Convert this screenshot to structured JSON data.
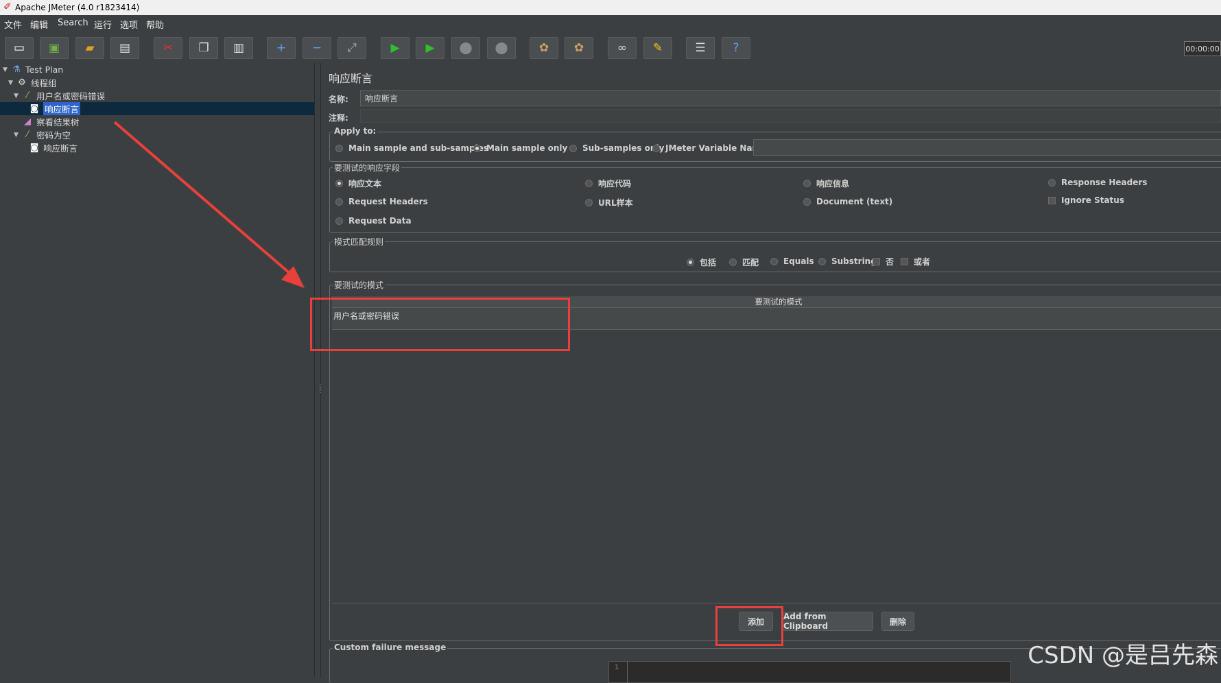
{
  "window": {
    "title": "Apache JMeter (4.0 r1823414)"
  },
  "menubar": {
    "items": [
      "文件",
      "编辑",
      "Search",
      "运行",
      "选项",
      "帮助"
    ]
  },
  "toolbar": {
    "buttons": [
      "new-icon",
      "templates-icon",
      "open-icon",
      "save-icon",
      "cut-icon",
      "copy-icon",
      "paste-icon",
      "expand-icon",
      "collapse-icon",
      "toggle-icon",
      "start-icon",
      "start-no-pause-icon",
      "stop-icon",
      "shutdown-icon",
      "clear-icon",
      "clear-all-icon",
      "search-icon",
      "reset-search-icon",
      "function-helper-icon",
      "help-icon"
    ],
    "timer": "00:00:00"
  },
  "tree": {
    "nodes": [
      {
        "label": "Test Plan",
        "depth": 0,
        "icon": "flask-icon"
      },
      {
        "label": "线程组",
        "depth": 1,
        "icon": "gear-icon"
      },
      {
        "label": "用户名或密码错误",
        "depth": 2,
        "icon": "pipette-icon"
      },
      {
        "label": "响应断言",
        "depth": 3,
        "icon": "assertion-icon",
        "selected": true
      },
      {
        "label": "察看结果树",
        "depth": 2,
        "icon": "chart-icon"
      },
      {
        "label": "密码为空",
        "depth": 2,
        "icon": "pipette-icon"
      },
      {
        "label": "响应断言",
        "depth": 3,
        "icon": "assertion-icon"
      }
    ]
  },
  "panel": {
    "title": "响应断言",
    "name_label": "名称:",
    "name_value": "响应断言",
    "comment_label": "注释:",
    "apply_to": {
      "title": "Apply to:",
      "options": [
        "Main sample and sub-samples",
        "Main sample only",
        "Sub-samples only",
        "JMeter Variable Name to use"
      ],
      "selected": "Main sample only"
    },
    "field_to_test": {
      "title": "要测试的响应字段",
      "options": [
        "响应文本",
        "响应代码",
        "响应信息",
        "Response Headers",
        "Request Headers",
        "URL样本",
        "Document (text)",
        "Request Data"
      ],
      "ignore_status": "Ignore Status",
      "selected": "响应文本"
    },
    "matching_rules": {
      "title": "模式匹配规则",
      "radios": [
        "包括",
        "匹配",
        "Equals",
        "Substring"
      ],
      "checks": [
        "否",
        "或者"
      ],
      "selected": "包括"
    },
    "patterns": {
      "title": "要测试的模式",
      "column_header": "要测试的模式",
      "rows": [
        "用户名或密码错误"
      ]
    },
    "buttons": {
      "add": "添加",
      "add_clipboard": "Add from Clipboard",
      "delete": "删除"
    },
    "custom_failure": {
      "title": "Custom failure message",
      "line_number": "1"
    }
  },
  "watermark": "CSDN @是吕先森",
  "colors": {
    "annotation": "#e8403a",
    "selection": "#2f65ca",
    "background": "#3c3f41"
  }
}
